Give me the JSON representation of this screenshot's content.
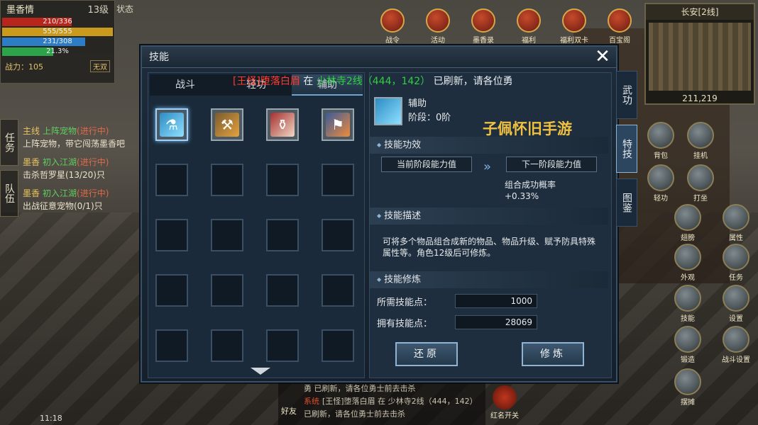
{
  "player": {
    "name": "墨香情",
    "level": "13级",
    "state_tab": "状态",
    "hp": "210/336",
    "mp": "555/555",
    "exp": "231/308",
    "extra": "21.3%",
    "combat_label": "战力：",
    "combat_value": "105",
    "wushuang": "无双",
    "hp_fill": 0.625,
    "mp_fill": 1.0,
    "exp_fill": 0.75,
    "extra_fill": 0.46
  },
  "top_icons": [
    {
      "label": "战令",
      "icon": "war-order-icon"
    },
    {
      "label": "活动",
      "icon": "activity-icon"
    },
    {
      "label": "墨香录",
      "icon": "book-icon"
    },
    {
      "label": "福利",
      "icon": "gift-icon"
    },
    {
      "label": "福利双卡",
      "icon": "card-icon"
    },
    {
      "label": "百宝阁",
      "icon": "treasure-icon"
    }
  ],
  "minimap": {
    "title": "长安[2线]",
    "coords": "211,219"
  },
  "quest_side_tabs": [
    "任务",
    "队伍"
  ],
  "quests": [
    {
      "tag": "主线",
      "name": "上阵宠物",
      "status": "(进行中)",
      "desc": "上阵宠物，带它闯荡墨香吧"
    },
    {
      "tag": "墨香",
      "name": "初入江湖",
      "status": "(进行中)",
      "desc": "击杀哲罗星(13/20)只"
    },
    {
      "tag": "墨香",
      "name": "初入江湖",
      "status": "(进行中)",
      "desc": "出战征意宠物(0/1)只"
    }
  ],
  "dialog": {
    "title": "技能",
    "close": "✕",
    "tabs": [
      "战斗",
      "轻功",
      "辅助"
    ],
    "active_tab": 2,
    "skill": {
      "name": "辅助",
      "stage": "阶段：0阶"
    },
    "effect_header": "技能功效",
    "current_label": "当前阶段能力值",
    "next_label": "下一阶段能力值",
    "effect_name": "组合成功概率",
    "effect_value": "+0.33%",
    "desc_header": "技能描述",
    "desc_text": "可将多个物品组合成新的物品、物品升级、赋予防具特殊属性等。角色12级后可修炼。",
    "train_header": "技能修炼",
    "need_label": "所需技能点：",
    "need_value": "1000",
    "own_label": "拥有技能点：",
    "own_value": "28069",
    "reset_btn": "还原",
    "train_btn": "修炼",
    "side_tabs": [
      "武功",
      "特技",
      "图鉴"
    ],
    "active_side": 1
  },
  "notice": {
    "boss": "[王怪]堕落白眉",
    "mid": "在",
    "place": "少林寺2线（444，142）",
    "tail": "已刷新，请各位勇"
  },
  "watermark": "子佩怀旧手游",
  "right_buttons": [
    {
      "label": "背包",
      "icon": "bag-icon"
    },
    {
      "label": "挂机",
      "icon": "auto-icon"
    },
    {
      "label": "轻功",
      "icon": "qinggong-icon"
    },
    {
      "label": "打坐",
      "icon": "meditate-icon"
    },
    {
      "label": "翅膀",
      "icon": "wing-icon"
    },
    {
      "label": "属性",
      "icon": "attr-icon"
    },
    {
      "label": "外观",
      "icon": "look-icon"
    },
    {
      "label": "任务",
      "icon": "task-icon"
    },
    {
      "label": "技能",
      "icon": "skill-icon"
    },
    {
      "label": "设置",
      "icon": "settings-icon"
    },
    {
      "label": "锻造",
      "icon": "forge-icon"
    },
    {
      "label": "战斗设置",
      "icon": "combat-settings-icon"
    },
    {
      "label": "摆摊",
      "icon": "stall-icon"
    }
  ],
  "chat": {
    "friend": "好友",
    "sys": "系统",
    "line1": "勇 已刷新，请各位勇士前去击杀",
    "line2": "[王怪]堕落白眉 在 少林寺2线（444，142）",
    "line3": "已刷新，请各位勇士前去击杀"
  },
  "red_name": "红名开关",
  "clock": "11:18"
}
